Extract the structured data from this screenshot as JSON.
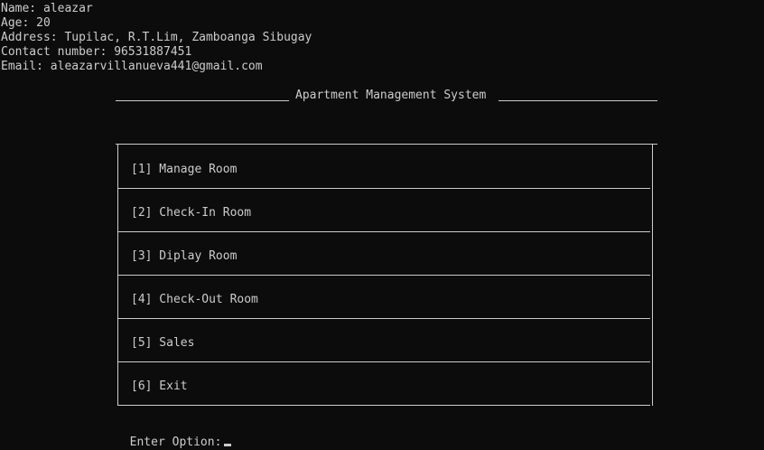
{
  "info": {
    "name": "Name: aleazar",
    "age": "Age: 20",
    "address": "Address: Tupilac, R.T.Lim, Zamboanga Sibugay",
    "contact": "Contact number: 96531887451",
    "email": "Email: aleazarvillanueva441@gmail.com"
  },
  "title": "Apartment Management System",
  "menu": {
    "items": [
      {
        "label": "[1] Manage Room"
      },
      {
        "label": "[2] Check-In Room"
      },
      {
        "label": "[3] Diplay Room"
      },
      {
        "label": "[4] Check-Out Room"
      },
      {
        "label": "[5] Sales"
      },
      {
        "label": "[6] Exit"
      }
    ]
  },
  "prompt": "Enter Option:"
}
